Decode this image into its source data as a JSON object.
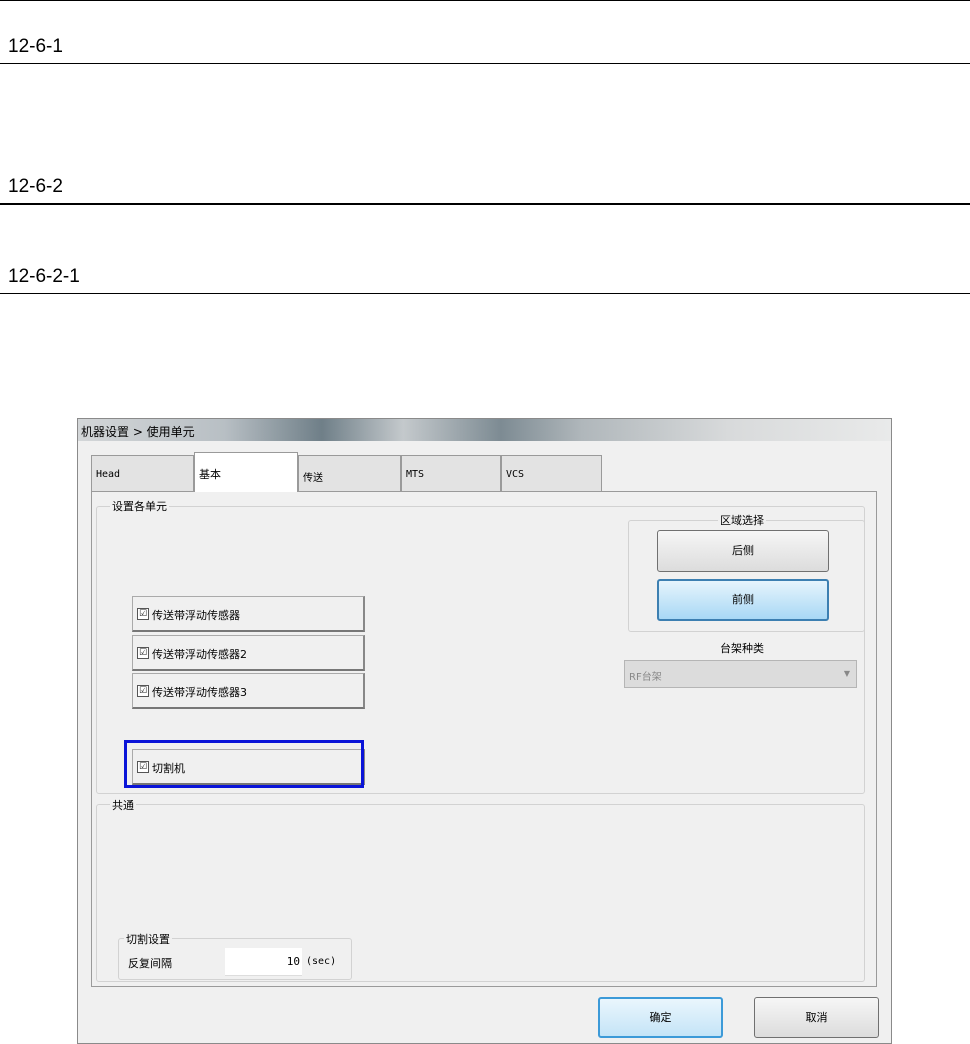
{
  "doc": {
    "headings": [
      "12-6-1",
      "12-6-2",
      "12-6-2-1"
    ]
  },
  "dialog": {
    "title": "机器设置 > 使用单元",
    "tabs": [
      {
        "label": "Head"
      },
      {
        "label": "基本",
        "active": true
      },
      {
        "label": "传送"
      },
      {
        "label": "MTS"
      },
      {
        "label": "VCS"
      }
    ],
    "units_group": {
      "label": "设置各单元",
      "items": [
        {
          "label": "传送带浮动传感器",
          "checked": true
        },
        {
          "label": "传送带浮动传感器2",
          "checked": true
        },
        {
          "label": "传送带浮动传感器3",
          "checked": true
        },
        {
          "label": "切割机",
          "checked": true,
          "highlighted": true
        }
      ],
      "checkmark": "☑"
    },
    "zone_group": {
      "label": "区域选择",
      "rear_label": "后侧",
      "front_label": "前侧",
      "selected": "前侧"
    },
    "rack_type": {
      "label": "台架种类",
      "value": "RF台架",
      "disabled": true
    },
    "common_group": {
      "label": "共通",
      "cutter_settings": {
        "label": "切割设置",
        "interval_label": "反复间隔",
        "interval_value": "10",
        "interval_unit": "(sec)"
      }
    },
    "ok_label": "确定",
    "cancel_label": "取消"
  },
  "colors": {
    "highlight": "#0a14d8",
    "selected_button": "#a8d8f5"
  }
}
